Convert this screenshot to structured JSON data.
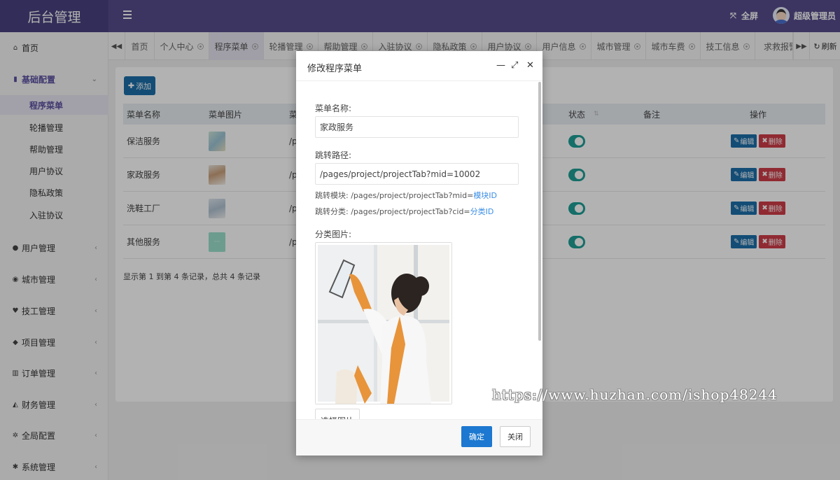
{
  "header": {
    "brand": "后台管理",
    "fullscreen_label": "全屏",
    "user_name": "超级管理员"
  },
  "sidebar": {
    "items": [
      {
        "label": "首页",
        "icon": "home-icon"
      },
      {
        "label": "基础配置",
        "icon": "bookmark-icon",
        "expanded": true
      },
      {
        "label": "用户管理",
        "icon": "user-icon"
      },
      {
        "label": "城市管理",
        "icon": "globe-icon"
      },
      {
        "label": "技工管理",
        "icon": "heart-icon"
      },
      {
        "label": "项目管理",
        "icon": "tag-icon"
      },
      {
        "label": "订单管理",
        "icon": "bar-chart-icon"
      },
      {
        "label": "财务管理",
        "icon": "area-chart-icon"
      },
      {
        "label": "全局配置",
        "icon": "gears-icon"
      },
      {
        "label": "系统管理",
        "icon": "gear-icon"
      }
    ],
    "sub_items": [
      "程序菜单",
      "轮播管理",
      "帮助管理",
      "用户协议",
      "隐私政策",
      "入驻协议"
    ]
  },
  "tabs": {
    "items": [
      "首页",
      "个人中心",
      "程序菜单",
      "轮播管理",
      "帮助管理",
      "入驻协议",
      "隐私政策",
      "用户协议",
      "用户信息",
      "城市管理",
      "城市车费",
      "技工信息",
      "求救报警"
    ],
    "active": "程序菜单",
    "refresh_label": "刷新"
  },
  "content": {
    "add_label": "添加",
    "columns": [
      "菜单名称",
      "菜单图片",
      "菜",
      "状态",
      "备注",
      "操作"
    ],
    "rows": [
      {
        "name": "保洁服务",
        "path": "/pa"
      },
      {
        "name": "家政服务",
        "path": "/pa"
      },
      {
        "name": "洗鞋工厂",
        "path": "/pa"
      },
      {
        "name": "其他服务",
        "path": "/pa"
      }
    ],
    "edit_label": "编辑",
    "delete_label": "删除",
    "footer": "显示第 1 到第 4 条记录，总共 4 条记录"
  },
  "modal": {
    "title": "修改程序菜单",
    "name_label": "菜单名称:",
    "name_value": "家政服务",
    "path_label": "跳转路径:",
    "path_value": "/pages/project/projectTab?mid=10002",
    "hint_module_prefix": "跳转模块: /pages/project/projectTab?mid=",
    "hint_module_link": "模块ID",
    "hint_category_prefix": "跳转分类: /pages/project/projectTab?cid=",
    "hint_category_link": "分类ID",
    "image_label": "分类图片:",
    "choose_label": "选择图片",
    "ok_label": "确定",
    "close_label": "关闭"
  },
  "watermark": "https://www.huzhan.com/ishop48244"
}
